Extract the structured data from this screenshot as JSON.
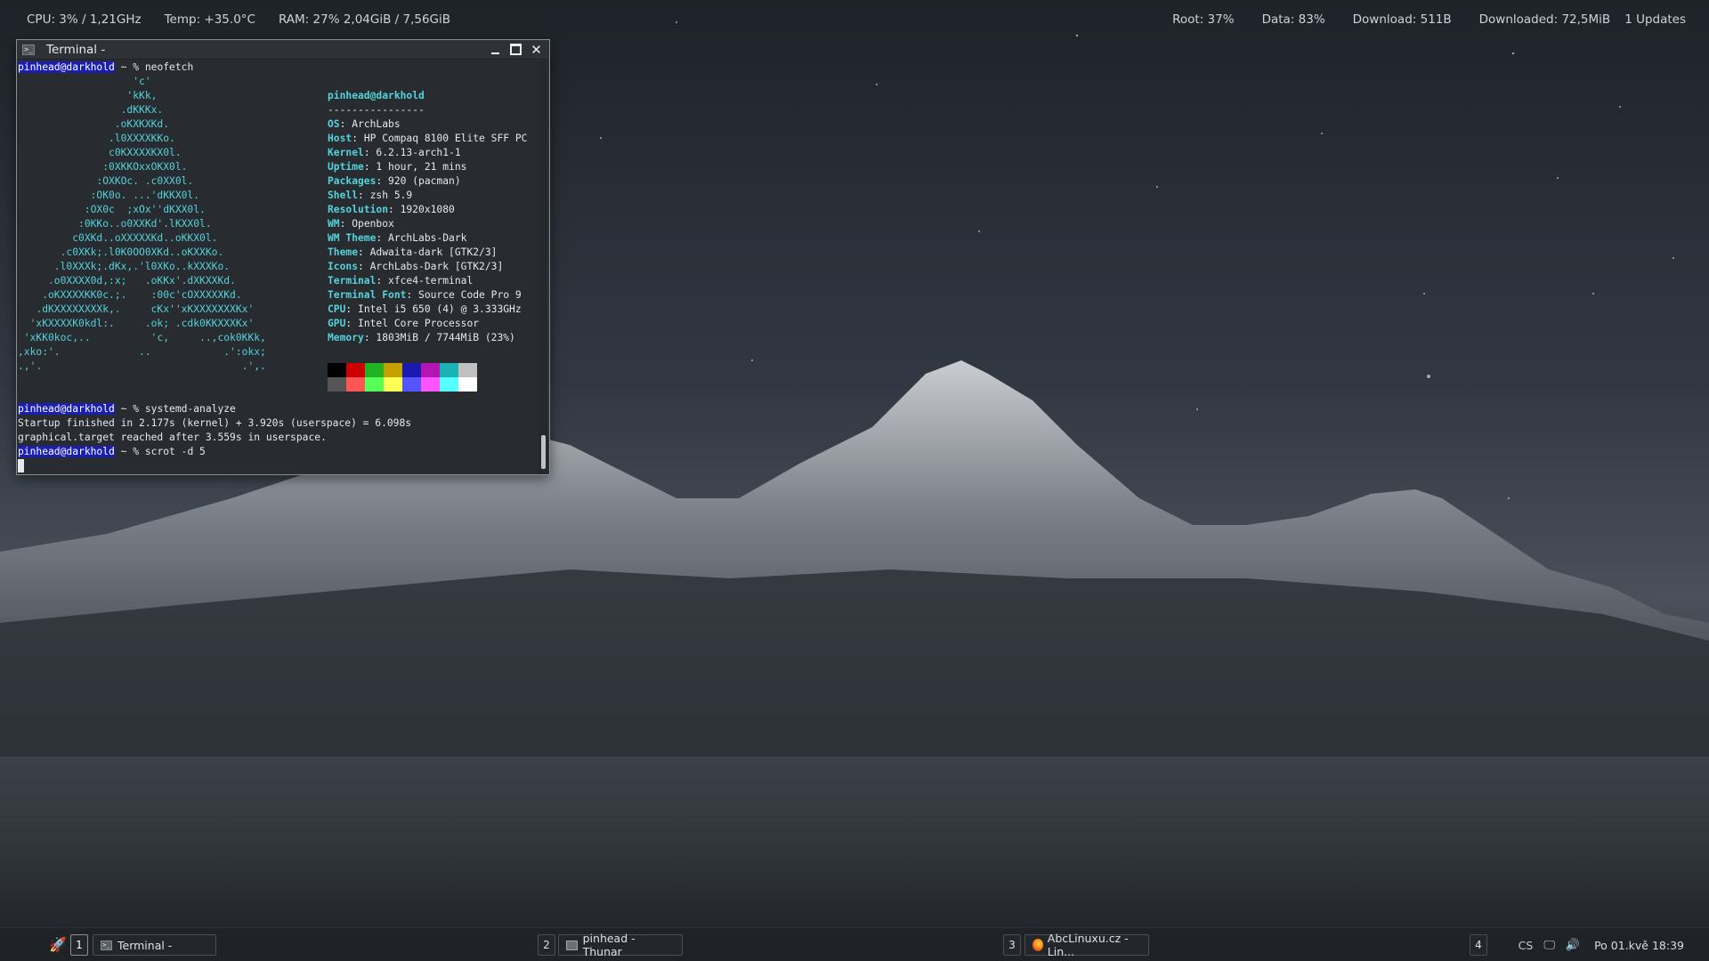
{
  "topbar": {
    "cpu": "CPU: 3% / 1,21GHz",
    "temp": "Temp: +35.0°C",
    "ram": "RAM: 27%  2,04GiB / 7,56GiB",
    "root": "Root: 37%",
    "data": "Data: 83%",
    "download": "Download: 511B",
    "downloaded": "Downloaded: 72,5MiB",
    "updates": "1 Updates"
  },
  "terminal": {
    "title": "Terminal -",
    "icon": "terminal-icon",
    "prompt_host": "pinhead@darkhold",
    "prompt_sep": " ~ % ",
    "cmd1": "neofetch",
    "ascii": [
      "                   'c'",
      "                  'kKk,",
      "                 .dKKKx.",
      "                .oKXKXKd.",
      "               .l0XXXXKKo.",
      "               c0KXXXXKX0l.",
      "              :0XKKOxxOKX0l.",
      "             :OXKOc. .c0XX0l.",
      "            :OK0o. ...'dKKX0l.",
      "           :OX0c  ;xOx''dKXX0l.",
      "          :0KKo..o0XXKd'.lKXX0l.",
      "         c0XKd..oXXXXXKd..oKKX0l.",
      "       .c0XKk;.l0K0OO0XKd..oKXXKo.",
      "      .l0XXXk;.dKx,.'l0XKo..kXXXKo.",
      "     .o0XXXX0d,:x;   .oKKx'.dXKXXKd.",
      "    .oKXXXXKK0c.;.    :00c'cOXXXXXKd.",
      "   .dKXXXXXXXXk,.     cKx''xKXXXXXXXKx'",
      "  'xKXXXXK0kdl:.     .ok; .cdk0KKXXXKx'",
      " 'xKK0koc,..          'c,     ..,cok0KKk,",
      ",xko:'.             ..            .':okx;",
      ".,'.                                 .',."
    ],
    "info_user": "pinhead@darkhold",
    "info_sep": "----------------",
    "info": [
      {
        "key": "OS",
        "value": "ArchLabs"
      },
      {
        "key": "Host",
        "value": "HP Compaq 8100 Elite SFF PC"
      },
      {
        "key": "Kernel",
        "value": "6.2.13-arch1-1"
      },
      {
        "key": "Uptime",
        "value": "1 hour, 21 mins"
      },
      {
        "key": "Packages",
        "value": "920 (pacman)"
      },
      {
        "key": "Shell",
        "value": "zsh 5.9"
      },
      {
        "key": "Resolution",
        "value": "1920x1080"
      },
      {
        "key": "WM",
        "value": "Openbox"
      },
      {
        "key": "WM Theme",
        "value": "ArchLabs-Dark"
      },
      {
        "key": "Theme",
        "value": "Adwaita-dark [GTK2/3]"
      },
      {
        "key": "Icons",
        "value": "ArchLabs-Dark [GTK2/3]"
      },
      {
        "key": "Terminal",
        "value": "xfce4-terminal"
      },
      {
        "key": "Terminal Font",
        "value": "Source Code Pro 9"
      },
      {
        "key": "CPU",
        "value": "Intel i5 650 (4) @ 3.333GHz"
      },
      {
        "key": "GPU",
        "value": "Intel Core Processor"
      },
      {
        "key": "Memory",
        "value": "1803MiB / 7744MiB (23%)"
      }
    ],
    "palette_top": [
      "#000000",
      "#cc0000",
      "#22b322",
      "#c4a000",
      "#1a1ab3",
      "#b316b3",
      "#1ab3b3",
      "#c0c0c0"
    ],
    "palette_bottom": [
      "#555555",
      "#ff5555",
      "#55ff55",
      "#ffff55",
      "#5555ff",
      "#ff55ff",
      "#55ffff",
      "#ffffff"
    ],
    "cmd2": "systemd-analyze",
    "out1": "Startup finished in 2.177s (kernel) + 3.920s (userspace) = 6.098s",
    "out2": "graphical.target reached after 3.559s in userspace.",
    "cmd3": "scrot -d 5"
  },
  "taskbar": {
    "launcher_icon": "rocket-icon",
    "ws1": "1",
    "task1": "Terminal -",
    "ws2": "2",
    "task2": "pinhead - Thunar",
    "ws3": "3",
    "task3": "AbcLinuxu.cz - Lin...",
    "ws4": "4",
    "lang": "CS",
    "clock": "Po 01.kvě 18:39"
  }
}
